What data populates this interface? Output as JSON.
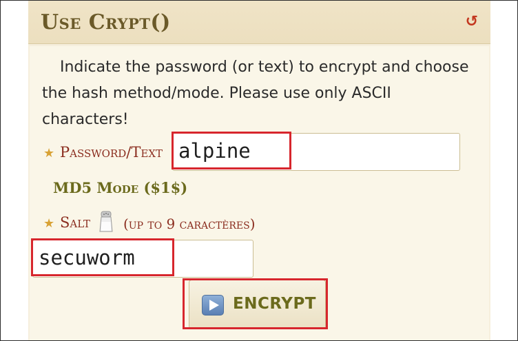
{
  "header": {
    "title": "Use Crypt()",
    "refresh_icon": "refresh-icon"
  },
  "intro": {
    "text": "Indicate the password (or text) to encrypt and choose the hash method/mode. Please use only ASCII characters!"
  },
  "password": {
    "label": "Password/Text",
    "value": "alpine"
  },
  "mode": {
    "text": "MD5 Mode ($1$)"
  },
  "salt": {
    "label": "Salt",
    "icon": "salt-shaker-icon",
    "note": "(up to 9 caractères)",
    "value": "secuworm"
  },
  "encrypt_button": {
    "label": "ENCRYPT",
    "icon": "play-icon"
  },
  "colors": {
    "accent_red": "#d7262d",
    "label_red": "#8b2d1f",
    "olive": "#6b6a1c",
    "panel_bg": "#f6efdd"
  }
}
